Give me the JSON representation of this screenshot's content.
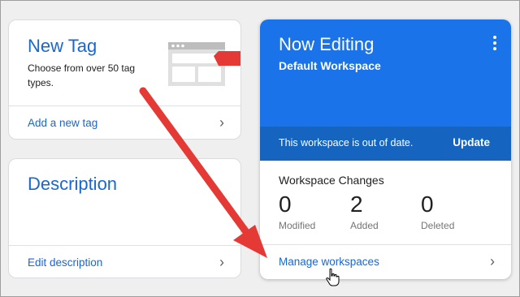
{
  "new_tag": {
    "title": "New Tag",
    "description": "Choose from over 50 tag types.",
    "link": "Add a new tag"
  },
  "description_card": {
    "title": "Description",
    "link": "Edit description"
  },
  "workspace": {
    "title": "Now Editing",
    "subtitle": "Default Workspace",
    "banner_text": "This workspace is out of date.",
    "update_label": "Update",
    "changes_title": "Workspace Changes",
    "stats": [
      {
        "value": "0",
        "label": "Modified"
      },
      {
        "value": "2",
        "label": "Added"
      },
      {
        "value": "0",
        "label": "Deleted"
      }
    ],
    "manage_link": "Manage workspaces"
  },
  "colors": {
    "accent": "#1a73e8",
    "banner": "#1565c0",
    "link": "#1967d2",
    "annotation_arrow": "#e53935"
  }
}
